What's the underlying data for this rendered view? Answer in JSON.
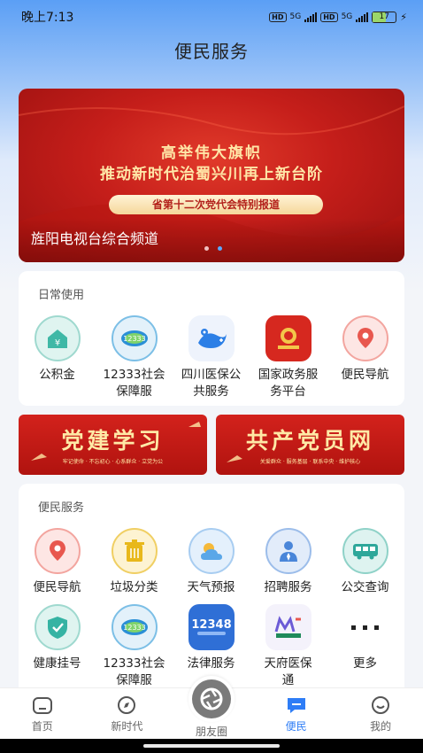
{
  "status": {
    "time": "晚上7:13",
    "hd1": "HD",
    "net1": "5G",
    "hd2": "HD",
    "net2": "5G",
    "battery": "17"
  },
  "header": {
    "title": "便民服务"
  },
  "banner": {
    "line1": "高举伟大旗帜",
    "line2": "推动新时代治蜀兴川再上新台阶",
    "pill": "省第十二次党代会特别报道",
    "caption": "旌阳电视台综合频道",
    "active_dot": 1
  },
  "daily": {
    "title": "日常使用",
    "items": [
      {
        "label": "公积金",
        "icon": "housing-fund-icon",
        "color": "#3fb8a6"
      },
      {
        "label": "12333社会保障服",
        "icon": "social-security-icon",
        "color": "#2a8fd6"
      },
      {
        "label": "四川医保公共服务",
        "icon": "medical-insurance-icon",
        "color": "#2c7fe6"
      },
      {
        "label": "国家政务服务平台",
        "icon": "national-gov-service-icon",
        "color": "#d6281f"
      },
      {
        "label": "便民导航",
        "icon": "navigation-icon",
        "color": "#e8574e"
      }
    ]
  },
  "promos": [
    {
      "title": "党建学习",
      "sub": "牢记使命 · 不忘初心 · 心系群众 · 立党为公"
    },
    {
      "title": "共产党员网",
      "sub": "关爱群众 · 服务基层 · 联系中央 · 维护核心"
    }
  ],
  "services": {
    "title": "便民服务",
    "row1": [
      {
        "label": "便民导航",
        "icon": "navigation-icon",
        "color": "#e8574e"
      },
      {
        "label": "垃圾分类",
        "icon": "trash-icon",
        "color": "#e8b81a"
      },
      {
        "label": "天气预报",
        "icon": "weather-icon",
        "color": "#5aa7e8"
      },
      {
        "label": "招聘服务",
        "icon": "recruitment-icon",
        "color": "#4a86d9"
      },
      {
        "label": "公交查询",
        "icon": "bus-icon",
        "color": "#2ea79a"
      }
    ],
    "row2": [
      {
        "label": "健康挂号",
        "icon": "health-registration-icon",
        "color": "#35b3a3"
      },
      {
        "label": "12333社会保障服",
        "icon": "social-security-icon",
        "color": "#2a8fd6"
      },
      {
        "label": "法律服务",
        "icon": "legal-service-icon",
        "color": "#2f6fd6"
      },
      {
        "label": "天府医保通",
        "icon": "tianfu-medical-icon",
        "color": "#6c5bd6"
      },
      {
        "label": "更多",
        "icon": "more-icon",
        "color": "#222222"
      }
    ]
  },
  "tabbar": {
    "items": [
      {
        "label": "首页",
        "icon": "home-icon"
      },
      {
        "label": "新时代",
        "icon": "compass-icon"
      },
      {
        "label": "朋友圈",
        "icon": "camera-aperture-icon"
      },
      {
        "label": "便民",
        "icon": "chat-bubble-icon",
        "active": true
      },
      {
        "label": "我的",
        "icon": "smile-icon"
      }
    ]
  }
}
